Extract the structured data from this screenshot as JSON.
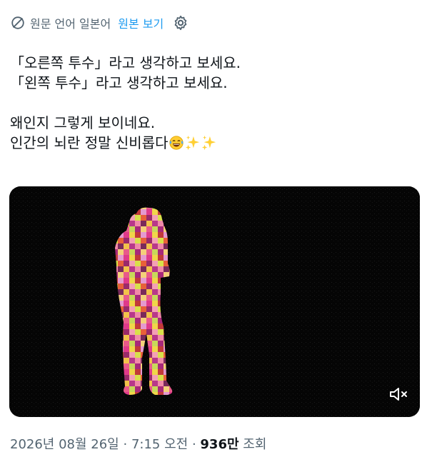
{
  "translation": {
    "source_label": "원문 언어 일본어",
    "view_original_label": "원본 보기"
  },
  "tweet": {
    "lines": [
      "「오른쪽 투수」라고 생각하고 보세요.",
      "「왼쪽 투수」라고 생각하고 보세요.",
      "",
      "왜인지 그렇게 보이네요.",
      "인간의 뇌란 정말 신비롭다"
    ],
    "emojis": [
      "face-with-tears-of-joy",
      "sparkles",
      "sparkles"
    ]
  },
  "media": {
    "type": "video",
    "description_icon": "mute-icon"
  },
  "meta": {
    "date": "2026년 08월 26일",
    "time": "7:15 오전",
    "views_count": "936만",
    "views_label": "조회"
  },
  "colors": {
    "text": "#0f1419",
    "secondary": "#536471",
    "accent": "#1d9bf0",
    "media_bg": "#050505"
  }
}
